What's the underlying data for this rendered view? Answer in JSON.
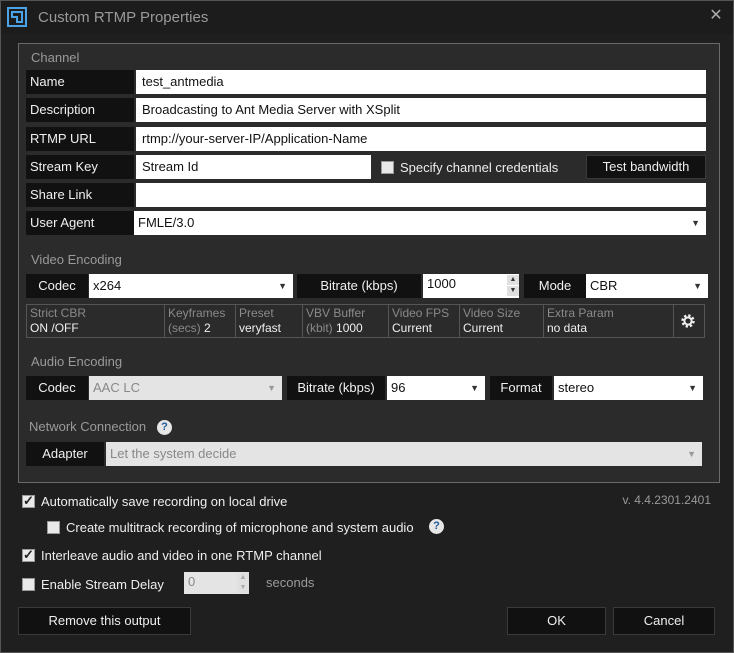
{
  "window": {
    "title": "Custom RTMP Properties",
    "close_icon": "close-icon"
  },
  "channel": {
    "section": "Channel",
    "name_label": "Name",
    "name_value": "test_antmedia",
    "description_label": "Description",
    "description_value": "Broadcasting to Ant Media Server with XSplit",
    "url_label": "RTMP URL",
    "url_value": "rtmp://your-server-IP/Application-Name",
    "key_label": "Stream Key",
    "key_value": "Stream Id",
    "credentials_label": "Specify channel credentials",
    "test_bandwidth": "Test bandwidth",
    "share_label": "Share Link",
    "share_value": "",
    "agent_label": "User Agent",
    "agent_value": "FMLE/3.0"
  },
  "video": {
    "section": "Video Encoding",
    "codec_label": "Codec",
    "codec_value": "x264",
    "bitrate_label": "Bitrate (kbps)",
    "bitrate_value": "1000",
    "mode_label": "Mode",
    "mode_value": "CBR",
    "grid": {
      "strict_h": "Strict CBR",
      "strict_on": "ON",
      "strict_sep": "/",
      "strict_off": "OFF",
      "kf_h": "Keyframes",
      "kf_unit": "(secs)",
      "kf_v": "2",
      "preset_h": "Preset",
      "preset_v": "veryfast",
      "vbv_h": "VBV Buffer",
      "vbv_unit": "(kbit)",
      "vbv_v": "1000",
      "fps_h": "Video FPS",
      "fps_v": "Current",
      "size_h": "Video Size",
      "size_v": "Current",
      "extra_h": "Extra Param",
      "extra_v": "no data"
    }
  },
  "audio": {
    "section": "Audio Encoding",
    "codec_label": "Codec",
    "codec_value": "AAC LC",
    "bitrate_label": "Bitrate (kbps)",
    "bitrate_value": "96",
    "format_label": "Format",
    "format_value": "stereo"
  },
  "network": {
    "section": "Network Connection",
    "adapter_label": "Adapter",
    "adapter_value": "Let the system decide"
  },
  "options": {
    "autosave": "Automatically save recording on local drive",
    "multitrack": "Create multitrack recording of microphone and system audio",
    "interleave": "Interleave audio and video in one RTMP channel",
    "delay": "Enable Stream Delay",
    "delay_value": "0",
    "delay_unit": "seconds",
    "version": "v. 4.4.2301.2401"
  },
  "footer": {
    "remove": "Remove this output",
    "ok": "OK",
    "cancel": "Cancel"
  },
  "colors": {
    "background": "#1f1f1f",
    "panel": "#2b2b2b",
    "label_bg": "#111111",
    "accent": "#1f5a9a"
  }
}
